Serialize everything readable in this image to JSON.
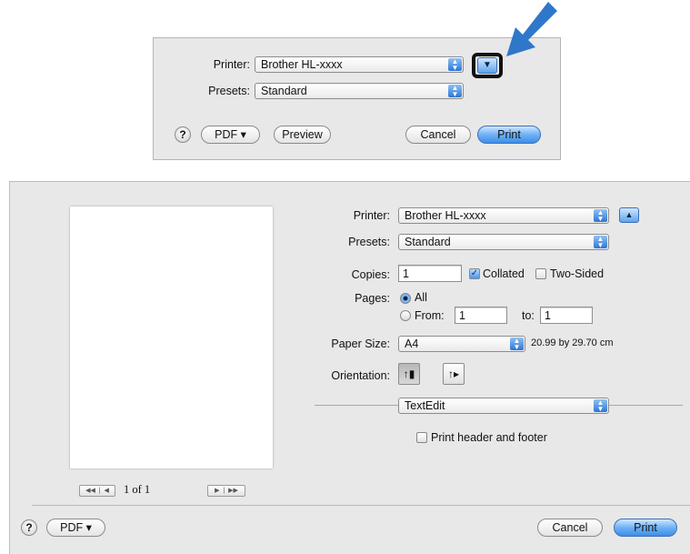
{
  "top_dialog": {
    "printer_label": "Printer:",
    "printer_value": "Brother HL-xxxx",
    "presets_label": "Presets:",
    "presets_value": "Standard",
    "help": "?",
    "pdf": "PDF ▾",
    "preview": "Preview",
    "cancel": "Cancel",
    "print": "Print",
    "expand_icon": "disclosure-down-icon"
  },
  "annotation": {
    "arrow_color": "#2f78c9",
    "highlight_color": "#111111"
  },
  "main_dialog": {
    "printer_label": "Printer:",
    "printer_value": "Brother HL-xxxx",
    "presets_label": "Presets:",
    "presets_value": "Standard",
    "copies_label": "Copies:",
    "copies_value": "1",
    "collated_label": "Collated",
    "collated_checked": true,
    "two_sided_label": "Two-Sided",
    "two_sided_checked": false,
    "pages_label": "Pages:",
    "pages_all": "All",
    "pages_from": "From:",
    "from_value": "1",
    "to_label": "to:",
    "to_value": "1",
    "paper_size_label": "Paper Size:",
    "paper_size_value": "A4",
    "paper_dims": "20.99 by 29.70 cm",
    "orientation_label": "Orientation:",
    "section_value": "TextEdit",
    "header_footer_label": "Print header and footer",
    "page_indicator": "1 of 1",
    "help": "?",
    "pdf": "PDF ▾",
    "cancel": "Cancel",
    "print": "Print"
  }
}
